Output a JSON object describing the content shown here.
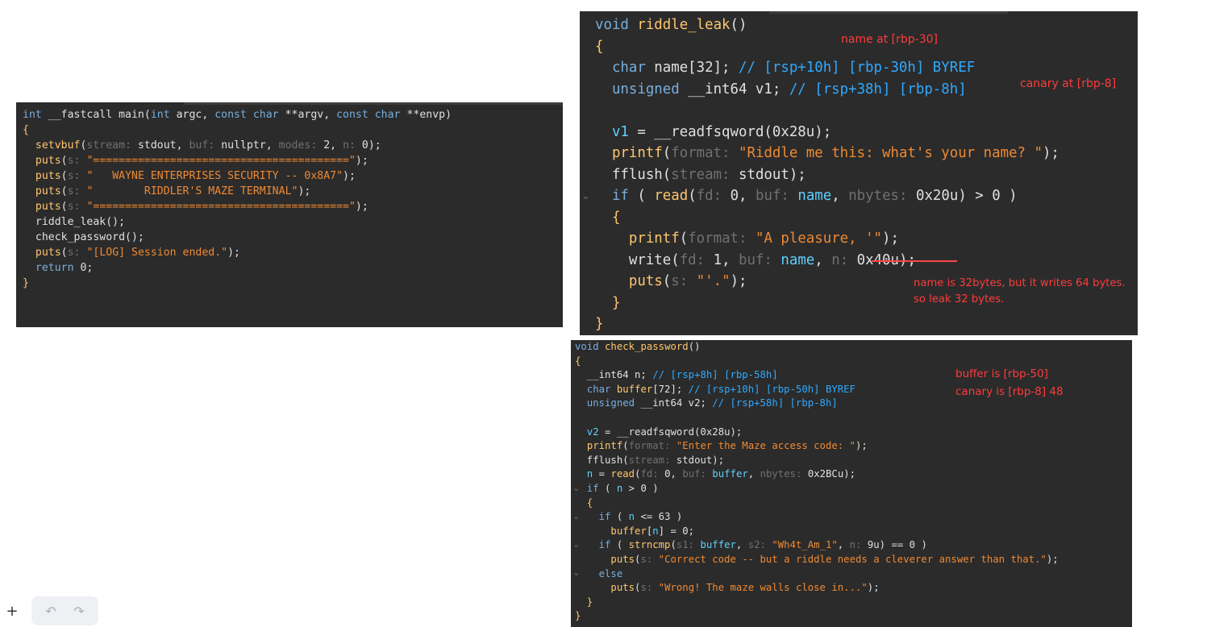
{
  "main_panel": {
    "lines": [
      [
        {
          "c": "kw",
          "t": "int "
        },
        {
          "c": "tx",
          "t": "__fastcall main("
        },
        {
          "c": "kw",
          "t": "int "
        },
        {
          "c": "tx",
          "t": "argc, "
        },
        {
          "c": "kw",
          "t": "const char "
        },
        {
          "c": "tx",
          "t": "**argv, "
        },
        {
          "c": "kw",
          "t": "const char "
        },
        {
          "c": "tx",
          "t": "**envp)"
        }
      ],
      [
        {
          "c": "fn",
          "t": "{"
        }
      ],
      [
        {
          "c": "tx",
          "t": "  "
        },
        {
          "c": "fn",
          "t": "setvbuf"
        },
        {
          "c": "tx",
          "t": "("
        },
        {
          "c": "pm",
          "t": "stream: "
        },
        {
          "c": "tx",
          "t": "stdout, "
        },
        {
          "c": "pm",
          "t": "buf: "
        },
        {
          "c": "tx",
          "t": "nullptr, "
        },
        {
          "c": "pm",
          "t": "modes: "
        },
        {
          "c": "tx",
          "t": "2, "
        },
        {
          "c": "pm",
          "t": "n: "
        },
        {
          "c": "tx",
          "t": "0);"
        }
      ],
      [
        {
          "c": "tx",
          "t": "  "
        },
        {
          "c": "fn",
          "t": "puts"
        },
        {
          "c": "tx",
          "t": "("
        },
        {
          "c": "pm",
          "t": "s: "
        },
        {
          "c": "str",
          "t": "\"========================================\""
        },
        {
          "c": "tx",
          "t": ");"
        }
      ],
      [
        {
          "c": "tx",
          "t": "  "
        },
        {
          "c": "fn",
          "t": "puts"
        },
        {
          "c": "tx",
          "t": "("
        },
        {
          "c": "pm",
          "t": "s: "
        },
        {
          "c": "str",
          "t": "\"   WAYNE ENTERPRISES SECURITY -- 0x8A7\""
        },
        {
          "c": "tx",
          "t": ");"
        }
      ],
      [
        {
          "c": "tx",
          "t": "  "
        },
        {
          "c": "fn",
          "t": "puts"
        },
        {
          "c": "tx",
          "t": "("
        },
        {
          "c": "pm",
          "t": "s: "
        },
        {
          "c": "str",
          "t": "\"        RIDDLER'S MAZE TERMINAL\""
        },
        {
          "c": "tx",
          "t": ");"
        }
      ],
      [
        {
          "c": "tx",
          "t": "  "
        },
        {
          "c": "fn",
          "t": "puts"
        },
        {
          "c": "tx",
          "t": "("
        },
        {
          "c": "pm",
          "t": "s: "
        },
        {
          "c": "str",
          "t": "\"========================================\""
        },
        {
          "c": "tx",
          "t": ");"
        }
      ],
      [
        {
          "c": "tx",
          "t": "  riddle_leak();"
        }
      ],
      [
        {
          "c": "tx",
          "t": "  check_password();"
        }
      ],
      [
        {
          "c": "tx",
          "t": "  "
        },
        {
          "c": "fn",
          "t": "puts"
        },
        {
          "c": "tx",
          "t": "("
        },
        {
          "c": "pm",
          "t": "s: "
        },
        {
          "c": "str",
          "t": "\"[LOG] Session ended.\""
        },
        {
          "c": "tx",
          "t": ");"
        }
      ],
      [
        {
          "c": "kw",
          "t": "  return "
        },
        {
          "c": "tx",
          "t": "0;"
        }
      ],
      [
        {
          "c": "fn",
          "t": "}"
        }
      ]
    ]
  },
  "riddle_panel": {
    "lines": [
      [
        {
          "c": "kw",
          "t": "void "
        },
        {
          "c": "fn",
          "t": "riddle_leak"
        },
        {
          "c": "tx",
          "t": "()"
        }
      ],
      [
        {
          "c": "fn",
          "t": "{"
        }
      ],
      [
        {
          "c": "kw",
          "t": "  char "
        },
        {
          "c": "tx",
          "t": "name[32]; "
        },
        {
          "c": "cm",
          "t": "// [rsp+10h] [rbp-30h] BYREF"
        }
      ],
      [
        {
          "c": "kw",
          "t": "  unsigned "
        },
        {
          "c": "tx",
          "t": "__int64 v1; "
        },
        {
          "c": "cm",
          "t": "// [rsp+38h] [rbp-8h]"
        }
      ],
      [
        {
          "c": "tx",
          "t": ""
        }
      ],
      [
        {
          "c": "vr",
          "t": "  v1 "
        },
        {
          "c": "tx",
          "t": "= __readfsqword(0x28u);"
        }
      ],
      [
        {
          "c": "tx",
          "t": "  "
        },
        {
          "c": "fn",
          "t": "printf"
        },
        {
          "c": "tx",
          "t": "("
        },
        {
          "c": "pm",
          "t": "format: "
        },
        {
          "c": "str",
          "t": "\"Riddle me this: what's your name? \""
        },
        {
          "c": "tx",
          "t": ");"
        }
      ],
      [
        {
          "c": "tx",
          "t": "  fflush("
        },
        {
          "c": "pm",
          "t": "stream: "
        },
        {
          "c": "tx",
          "t": "stdout);"
        }
      ],
      [
        {
          "c": "kw",
          "t": "  if "
        },
        {
          "c": "tx",
          "t": "( "
        },
        {
          "c": "fn",
          "t": "read"
        },
        {
          "c": "tx",
          "t": "("
        },
        {
          "c": "pm",
          "t": "fd: "
        },
        {
          "c": "tx",
          "t": "0, "
        },
        {
          "c": "pm",
          "t": "buf: "
        },
        {
          "c": "vr",
          "t": "name"
        },
        {
          "c": "tx",
          "t": ", "
        },
        {
          "c": "pm",
          "t": "nbytes: "
        },
        {
          "c": "tx",
          "t": "0x20u) > 0 )"
        }
      ],
      [
        {
          "c": "fn",
          "t": "  {"
        }
      ],
      [
        {
          "c": "tx",
          "t": "    "
        },
        {
          "c": "fn",
          "t": "printf"
        },
        {
          "c": "tx",
          "t": "("
        },
        {
          "c": "pm",
          "t": "format: "
        },
        {
          "c": "str",
          "t": "\"A pleasure, '\""
        },
        {
          "c": "tx",
          "t": ");"
        }
      ],
      [
        {
          "c": "tx",
          "t": "    write("
        },
        {
          "c": "pm",
          "t": "fd: "
        },
        {
          "c": "tx",
          "t": "1, "
        },
        {
          "c": "pm",
          "t": "buf: "
        },
        {
          "c": "vr",
          "t": "name"
        },
        {
          "c": "tx",
          "t": ", "
        },
        {
          "c": "pm",
          "t": "n: "
        },
        {
          "c": "tx",
          "t": "0x40u);"
        }
      ],
      [
        {
          "c": "tx",
          "t": "    "
        },
        {
          "c": "fn",
          "t": "puts"
        },
        {
          "c": "tx",
          "t": "("
        },
        {
          "c": "pm",
          "t": "s: "
        },
        {
          "c": "str",
          "t": "\"'.\""
        },
        {
          "c": "tx",
          "t": ");"
        }
      ],
      [
        {
          "c": "fn",
          "t": "  }"
        }
      ],
      [
        {
          "c": "fn",
          "t": "}"
        }
      ]
    ],
    "annotations": {
      "name_at": "name at [rbp-30]",
      "canary_at": "canary at [rbp-8]",
      "leak_note_1": "name is 32bytes, but it writes 64 bytes.",
      "leak_note_2": "so leak 32 bytes."
    }
  },
  "check_panel": {
    "lines": [
      [
        {
          "c": "kw",
          "t": "void "
        },
        {
          "c": "fn",
          "t": "check_password"
        },
        {
          "c": "tx",
          "t": "()"
        }
      ],
      [
        {
          "c": "fn",
          "t": "{"
        }
      ],
      [
        {
          "c": "tx",
          "t": "  __int64 n; "
        },
        {
          "c": "cm",
          "t": "// [rsp+8h] [rbp-58h]"
        }
      ],
      [
        {
          "c": "kw",
          "t": "  char "
        },
        {
          "c": "fn",
          "t": "buffer"
        },
        {
          "c": "tx",
          "t": "[72]; "
        },
        {
          "c": "cm",
          "t": "// [rsp+10h] [rbp-50h] BYREF"
        }
      ],
      [
        {
          "c": "kw",
          "t": "  unsigned "
        },
        {
          "c": "tx",
          "t": "__int64 v2; "
        },
        {
          "c": "cm",
          "t": "// [rsp+58h] [rbp-8h]"
        }
      ],
      [
        {
          "c": "tx",
          "t": ""
        }
      ],
      [
        {
          "c": "vr",
          "t": "  v2 "
        },
        {
          "c": "tx",
          "t": "= __readfsqword(0x28u);"
        }
      ],
      [
        {
          "c": "tx",
          "t": "  "
        },
        {
          "c": "fn",
          "t": "printf"
        },
        {
          "c": "tx",
          "t": "("
        },
        {
          "c": "pm",
          "t": "format: "
        },
        {
          "c": "str",
          "t": "\"Enter the Maze access code: \""
        },
        {
          "c": "tx",
          "t": ");"
        }
      ],
      [
        {
          "c": "tx",
          "t": "  fflush("
        },
        {
          "c": "pm",
          "t": "stream: "
        },
        {
          "c": "tx",
          "t": "stdout);"
        }
      ],
      [
        {
          "c": "vr",
          "t": "  n "
        },
        {
          "c": "tx",
          "t": "= "
        },
        {
          "c": "fn",
          "t": "read"
        },
        {
          "c": "tx",
          "t": "("
        },
        {
          "c": "pm",
          "t": "fd: "
        },
        {
          "c": "tx",
          "t": "0, "
        },
        {
          "c": "pm",
          "t": "buf: "
        },
        {
          "c": "vr",
          "t": "buffer"
        },
        {
          "c": "tx",
          "t": ", "
        },
        {
          "c": "pm",
          "t": "nbytes: "
        },
        {
          "c": "tx",
          "t": "0x2BCu);"
        }
      ],
      [
        {
          "c": "kw",
          "t": "  if "
        },
        {
          "c": "tx",
          "t": "( "
        },
        {
          "c": "vr",
          "t": "n "
        },
        {
          "c": "tx",
          "t": "> 0 )"
        }
      ],
      [
        {
          "c": "fn",
          "t": "  {"
        }
      ],
      [
        {
          "c": "kw",
          "t": "    if "
        },
        {
          "c": "tx",
          "t": "( "
        },
        {
          "c": "vr",
          "t": "n "
        },
        {
          "c": "tx",
          "t": "<= 63 )"
        }
      ],
      [
        {
          "c": "tx",
          "t": "      "
        },
        {
          "c": "fn",
          "t": "buffer"
        },
        {
          "c": "tx",
          "t": "["
        },
        {
          "c": "vr",
          "t": "n"
        },
        {
          "c": "tx",
          "t": "] = 0;"
        }
      ],
      [
        {
          "c": "kw",
          "t": "    if "
        },
        {
          "c": "tx",
          "t": "( "
        },
        {
          "c": "fn",
          "t": "strncmp"
        },
        {
          "c": "tx",
          "t": "("
        },
        {
          "c": "pm",
          "t": "s1: "
        },
        {
          "c": "vr",
          "t": "buffer"
        },
        {
          "c": "tx",
          "t": ", "
        },
        {
          "c": "pm",
          "t": "s2: "
        },
        {
          "c": "str",
          "t": "\"Wh4t_Am_1\""
        },
        {
          "c": "tx",
          "t": ", "
        },
        {
          "c": "pm",
          "t": "n: "
        },
        {
          "c": "tx",
          "t": "9u) == 0 )"
        }
      ],
      [
        {
          "c": "tx",
          "t": "      "
        },
        {
          "c": "fn",
          "t": "puts"
        },
        {
          "c": "tx",
          "t": "("
        },
        {
          "c": "pm",
          "t": "s: "
        },
        {
          "c": "str",
          "t": "\"Correct code -- but a riddle needs a cleverer answer than that.\""
        },
        {
          "c": "tx",
          "t": ");"
        }
      ],
      [
        {
          "c": "kw",
          "t": "    else"
        }
      ],
      [
        {
          "c": "tx",
          "t": "      "
        },
        {
          "c": "fn",
          "t": "puts"
        },
        {
          "c": "tx",
          "t": "("
        },
        {
          "c": "pm",
          "t": "s: "
        },
        {
          "c": "str",
          "t": "\"Wrong! The maze walls close in...\""
        },
        {
          "c": "tx",
          "t": ");"
        }
      ],
      [
        {
          "c": "fn",
          "t": "  }"
        }
      ],
      [
        {
          "c": "fn",
          "t": "}"
        }
      ]
    ],
    "annotations": {
      "buffer_at": "buffer is [rbp-50]",
      "canary_at": "canary is [rbp-8] 48"
    }
  },
  "toolbar": {
    "add_label": "+",
    "undo_label": "↶",
    "redo_label": "↷"
  },
  "colors": {
    "editor_bg": "#2b2b2b",
    "keyword": "#78aede",
    "function": "#ffc66d",
    "string": "#ee8a33",
    "comment": "#2fa9ff",
    "variable": "#5fd0ff",
    "param": "#707070",
    "annotation": "#ff3b3b"
  },
  "icons": {
    "collapse": "chevron-down-icon",
    "add": "plus-icon",
    "undo": "undo-icon",
    "redo": "redo-icon"
  }
}
